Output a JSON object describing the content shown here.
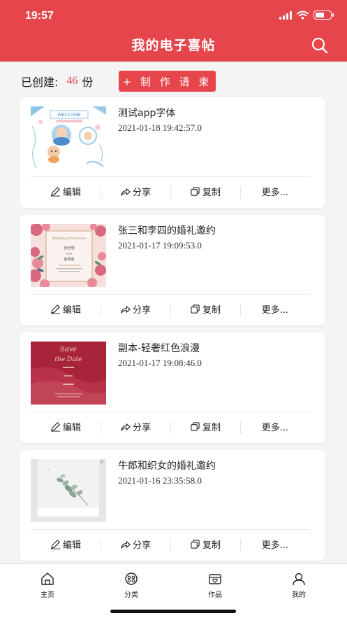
{
  "status_bar": {
    "time": "19:57"
  },
  "header": {
    "title": "我的电子喜帖"
  },
  "summary": {
    "label": "已创建:",
    "count": "46",
    "unit": "份"
  },
  "create_button": {
    "label": "+ 制 作 请 柬"
  },
  "actions": {
    "edit": "编辑",
    "share": "分享",
    "copy": "复制",
    "more": "更多..."
  },
  "cards": [
    {
      "title": "测试app字体",
      "date": "2021-01-18 19:42:57.0"
    },
    {
      "title": "张三和李四的婚礼邀约",
      "date": "2021-01-17 19:09:53.0"
    },
    {
      "title": "副本-轻奢红色浪漫",
      "date": "2021-01-17 19:08:46.0"
    },
    {
      "title": "牛郎和织女的婚礼邀约",
      "date": "2021-01-16 23:35:58.0"
    }
  ],
  "thumbs": {
    "thumb1": {
      "heading": "WELCOME"
    },
    "thumb2": {
      "heading": "Wedding Invitation",
      "name1": "张志明",
      "and": "And",
      "name2": "春香莉"
    },
    "thumb3": {
      "line1": "Save",
      "line2": "the Date"
    }
  },
  "tabbar": [
    {
      "label": "主页",
      "icon": "home-icon"
    },
    {
      "label": "分类",
      "icon": "category-icon"
    },
    {
      "label": "作品",
      "icon": "works-icon"
    },
    {
      "label": "我的",
      "icon": "profile-icon"
    }
  ],
  "colors": {
    "accent": "#e5454b"
  }
}
